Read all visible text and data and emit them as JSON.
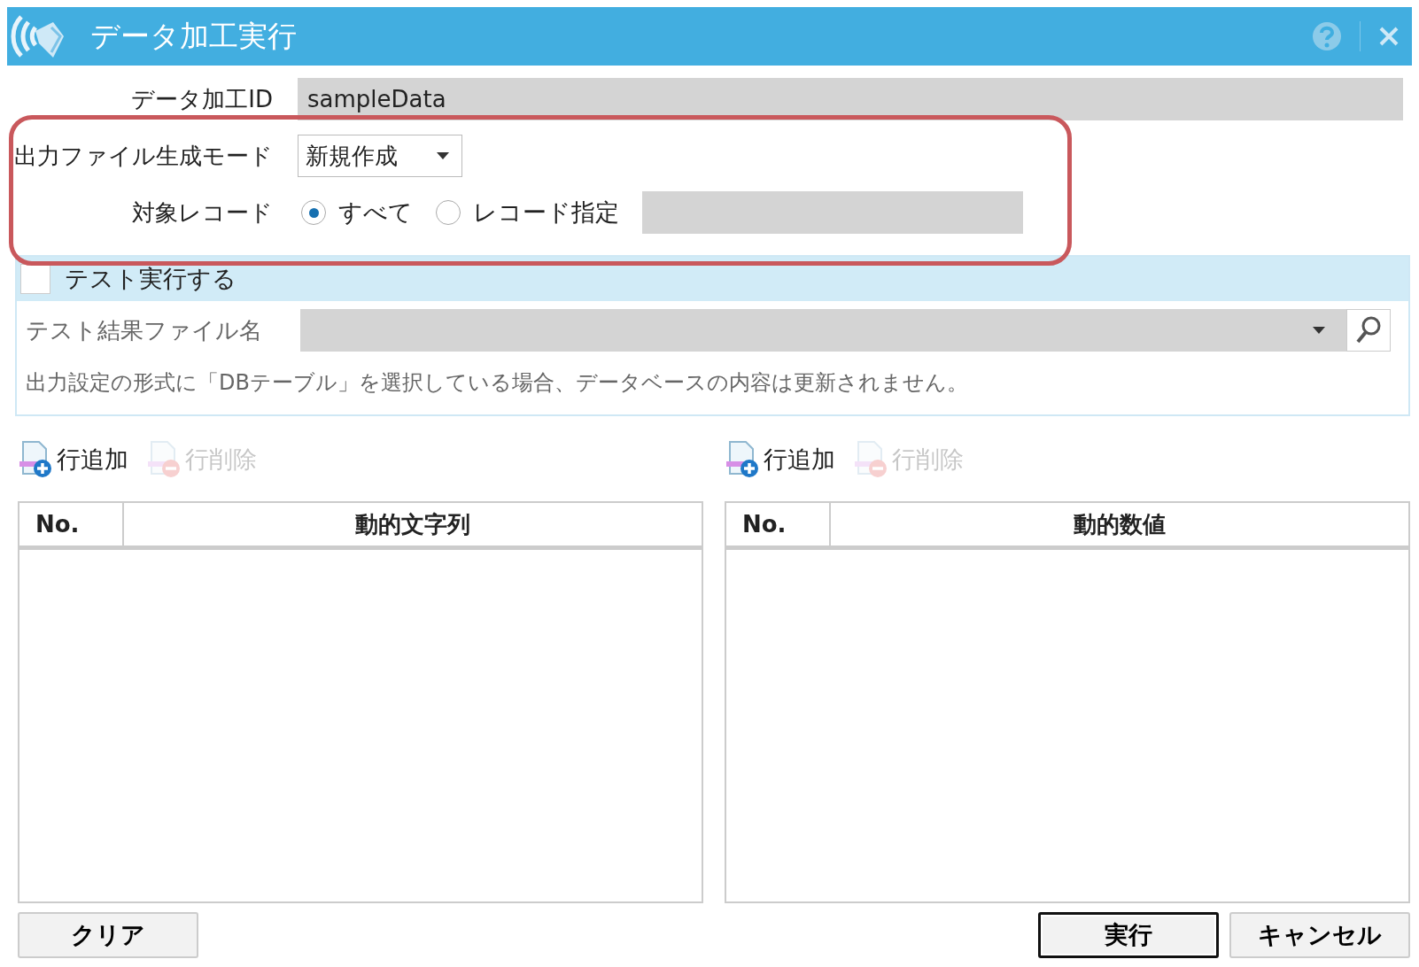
{
  "window": {
    "title": "データ加工実行"
  },
  "fields": {
    "data_id": {
      "label": "データ加工ID",
      "value": "sampleData",
      "disabled": true
    },
    "output_mode": {
      "label": "出力ファイル生成モード",
      "value": "新規作成"
    },
    "target_record": {
      "label": "対象レコード",
      "options": [
        {
          "label": "すべて",
          "selected": true
        },
        {
          "label": "レコード指定",
          "selected": false
        }
      ],
      "record_field_disabled": true
    }
  },
  "test_run": {
    "label": "テスト実行する",
    "checked": false,
    "file_label": "テスト結果ファイル名",
    "note": "出力設定の形式に「DBテーブル」を選択している場合、データベースの内容は更新されません。"
  },
  "tables": [
    {
      "toolbar": [
        {
          "kind": "add",
          "label": "行追加",
          "disabled": false
        },
        {
          "kind": "delete",
          "label": "行削除",
          "disabled": true
        }
      ],
      "columns": [
        "No.",
        "動的文字列"
      ]
    },
    {
      "toolbar": [
        {
          "kind": "add",
          "label": "行追加",
          "disabled": false
        },
        {
          "kind": "delete",
          "label": "行削除",
          "disabled": true
        }
      ],
      "columns": [
        "No.",
        "動的数値"
      ]
    }
  ],
  "buttons": {
    "left": "クリア",
    "execute": "実行",
    "cancel": "キャンセル"
  }
}
